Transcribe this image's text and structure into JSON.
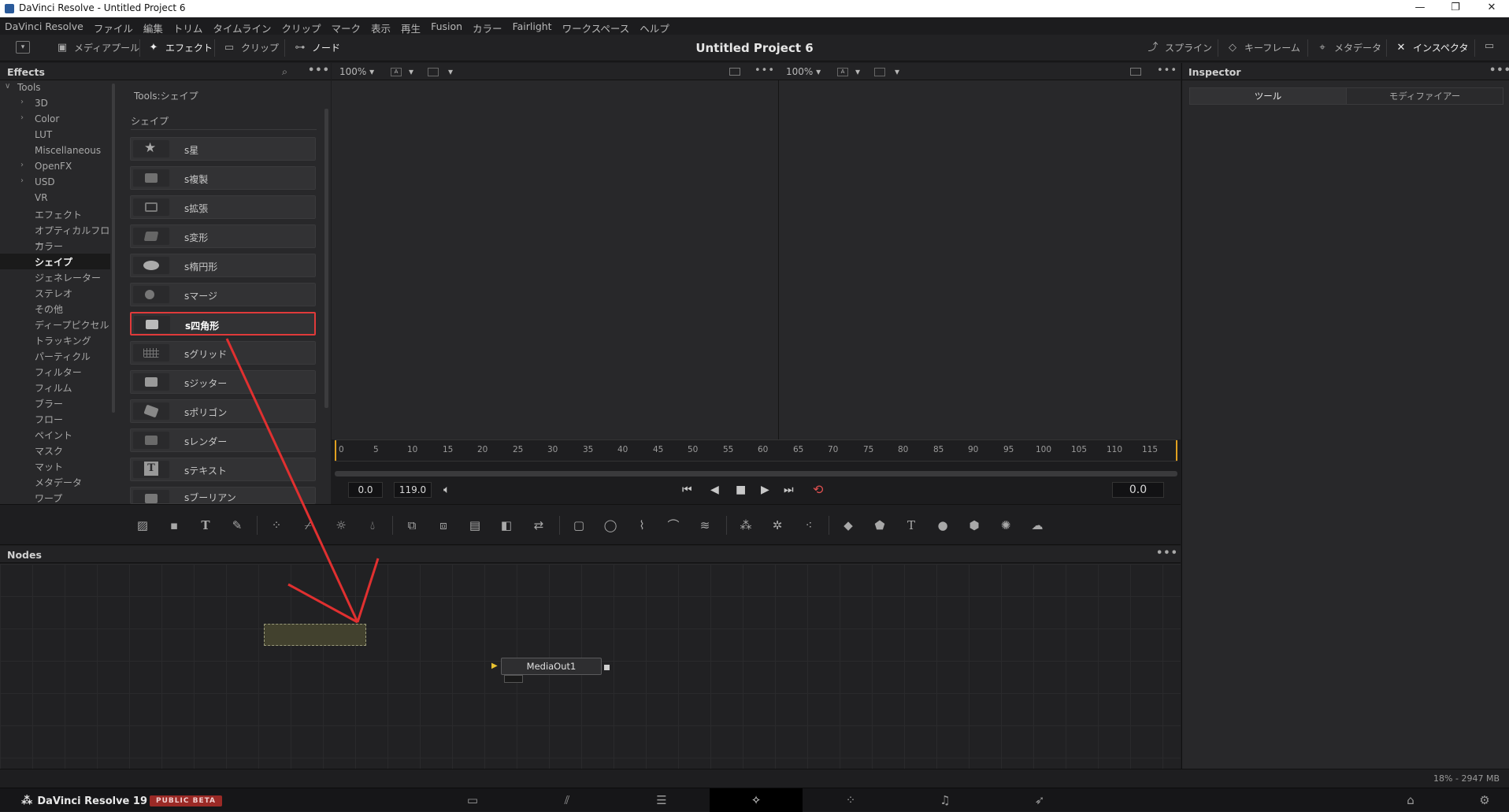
{
  "window": {
    "title": "DaVinci Resolve - Untitled Project 6",
    "controls": [
      "—",
      "❐",
      "✕"
    ]
  },
  "menu": [
    "DaVinci Resolve",
    "ファイル",
    "編集",
    "トリム",
    "タイムライン",
    "クリップ",
    "マーク",
    "表示",
    "再生",
    "Fusion",
    "カラー",
    "Fairlight",
    "ワークスペース",
    "ヘルプ"
  ],
  "toolbar": {
    "media_pool": "メディアプール",
    "effects": "エフェクト",
    "clips": "クリップ",
    "nodes": "ノード",
    "project_title": "Untitled Project 6",
    "spline": "スプライン",
    "keyframes": "キーフレーム",
    "metadata": "メタデータ",
    "inspector": "インスペクタ"
  },
  "effects": {
    "title": "Effects",
    "tree": [
      {
        "label": "Tools",
        "expanded": true,
        "level": 0
      },
      {
        "label": "3D",
        "chevron": true,
        "level": 1
      },
      {
        "label": "Color",
        "chevron": true,
        "level": 1
      },
      {
        "label": "LUT",
        "level": 1
      },
      {
        "label": "Miscellaneous",
        "level": 1
      },
      {
        "label": "OpenFX",
        "chevron": true,
        "level": 1
      },
      {
        "label": "USD",
        "chevron": true,
        "level": 1
      },
      {
        "label": "VR",
        "level": 1
      },
      {
        "label": "エフェクト",
        "level": 1
      },
      {
        "label": "オプティカルフロー",
        "level": 1
      },
      {
        "label": "カラー",
        "level": 1
      },
      {
        "label": "シェイプ",
        "level": 1,
        "selected": true
      },
      {
        "label": "ジェネレーター",
        "level": 1
      },
      {
        "label": "ステレオ",
        "level": 1
      },
      {
        "label": "その他",
        "level": 1
      },
      {
        "label": "ディープピクセル",
        "level": 1
      },
      {
        "label": "トラッキング",
        "level": 1
      },
      {
        "label": "パーティクル",
        "level": 1
      },
      {
        "label": "フィルター",
        "level": 1
      },
      {
        "label": "フィルム",
        "level": 1
      },
      {
        "label": "ブラー",
        "level": 1
      },
      {
        "label": "フロー",
        "level": 1
      },
      {
        "label": "ペイント",
        "level": 1
      },
      {
        "label": "マスク",
        "level": 1
      },
      {
        "label": "マット",
        "level": 1
      },
      {
        "label": "メタデータ",
        "level": 1
      },
      {
        "label": "ワープ",
        "level": 1
      }
    ],
    "breadcrumb": "Tools:シェイプ",
    "section": "シェイプ",
    "items": [
      {
        "label": "s星",
        "icon": "star-icon"
      },
      {
        "label": "s複製",
        "icon": "duplicate-icon"
      },
      {
        "label": "s拡張",
        "icon": "expand-icon"
      },
      {
        "label": "s変形",
        "icon": "transform-icon"
      },
      {
        "label": "s楕円形",
        "icon": "ellipse-icon"
      },
      {
        "label": "sマージ",
        "icon": "merge-icon"
      },
      {
        "label": "s四角形",
        "icon": "rectangle-icon",
        "selected": true
      },
      {
        "label": "sグリッド",
        "icon": "grid-icon"
      },
      {
        "label": "sジッター",
        "icon": "jitter-icon"
      },
      {
        "label": "sポリゴン",
        "icon": "polygon-icon"
      },
      {
        "label": "sレンダー",
        "icon": "render-icon"
      },
      {
        "label": "sテキスト",
        "icon": "text-icon"
      },
      {
        "label": "sブーリアン",
        "icon": "boolean-icon"
      }
    ]
  },
  "viewer": {
    "zoom_left": "100%",
    "zoom_right": "100%",
    "ruler_ticks": [
      "0",
      "5",
      "10",
      "15",
      "20",
      "25",
      "30",
      "35",
      "40",
      "45",
      "50",
      "55",
      "60",
      "65",
      "70",
      "75",
      "80",
      "85",
      "90",
      "95",
      "100",
      "105",
      "110",
      "115"
    ],
    "start": "0.0",
    "end": "119.0",
    "current": "0.0"
  },
  "nodes": {
    "title": "Nodes",
    "media_out": "MediaOut1"
  },
  "inspector": {
    "title": "Inspector",
    "tab_tools": "ツール",
    "tab_modifiers": "モディファイアー"
  },
  "status": {
    "memory": "18% - 2947 MB"
  },
  "bottom": {
    "brand": "DaVinci Resolve 19",
    "badge": "PUBLIC BETA",
    "pages": [
      "media",
      "cut",
      "edit",
      "fusion",
      "color",
      "fairlight",
      "deliver"
    ],
    "active_page": "fusion"
  },
  "colors": {
    "accent_red": "#e03a3a",
    "node_ghost": "#42412e",
    "beta_badge": "#9b2a26"
  }
}
